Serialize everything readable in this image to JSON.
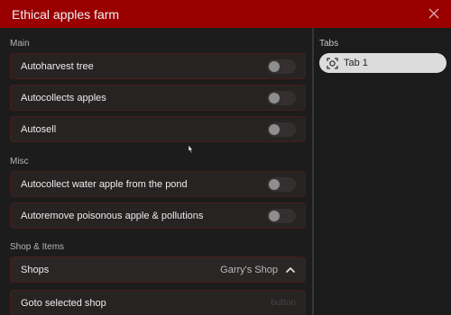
{
  "window": {
    "title": "Ethical apples farm",
    "close_icon": "close-icon"
  },
  "sections": {
    "main": {
      "label": "Main",
      "items": [
        {
          "label": "Autoharvest tree",
          "enabled": false
        },
        {
          "label": "Autocollects apples",
          "enabled": false
        },
        {
          "label": "Autosell",
          "enabled": false
        }
      ]
    },
    "misc": {
      "label": "Misc",
      "items": [
        {
          "label": "Autocollect water apple from the pond",
          "enabled": false
        },
        {
          "label": "Autoremove poisonous apple & pollutions",
          "enabled": false
        }
      ]
    },
    "shop": {
      "label": "Shop & Items",
      "shops_dropdown": {
        "label": "Shops",
        "value": "Garry's Shop",
        "icon": "chevron-up-icon"
      },
      "goto_button": {
        "label": "Goto selected shop",
        "hint": "button"
      }
    }
  },
  "tabs": {
    "label": "Tabs",
    "items": [
      {
        "label": "Tab 1",
        "icon": "tab-icon"
      }
    ]
  },
  "colors": {
    "titlebar": "#9b0000",
    "row_background": "#272323",
    "row_border": "#4a1b1b",
    "tab_active": "#dcdcdc"
  }
}
